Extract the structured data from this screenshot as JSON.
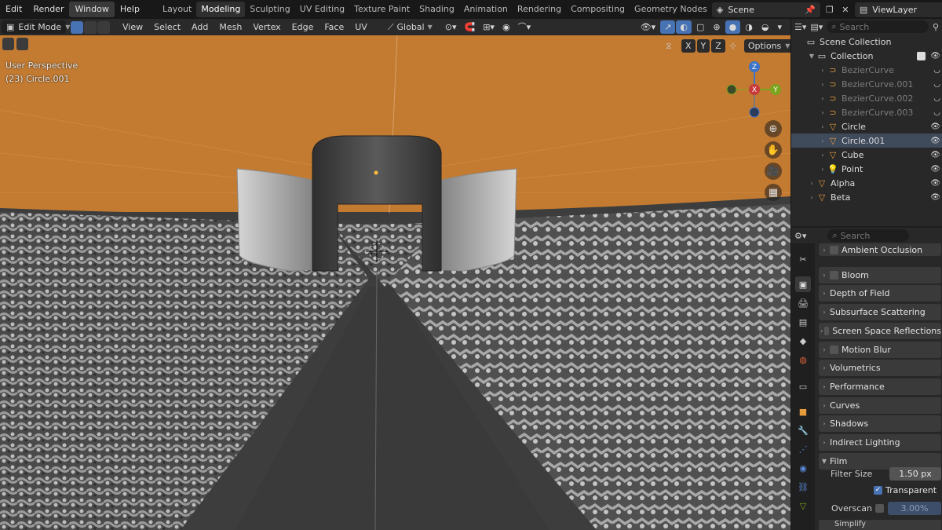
{
  "menu": [
    "Edit",
    "Render",
    "Window",
    "Help"
  ],
  "menu_active": "Window",
  "workspaces": [
    "Layout",
    "Modeling",
    "Sculpting",
    "UV Editing",
    "Texture Paint",
    "Shading",
    "Animation",
    "Rendering",
    "Compositing",
    "Geometry Nodes"
  ],
  "workspace_active": "Modeling",
  "scene_name": "Scene",
  "view_layer": "ViewLayer",
  "header": {
    "mode": "Edit Mode",
    "menus": [
      "View",
      "Select",
      "Add",
      "Mesh",
      "Vertex",
      "Edge",
      "Face",
      "UV"
    ],
    "transform_orientation": "Global",
    "axis_x": "X",
    "axis_y": "Y",
    "axis_z": "Z",
    "options": "Options"
  },
  "viewport": {
    "perspective": "User Perspective",
    "object": "(23) Circle.001"
  },
  "gizmo": {
    "x": "X",
    "y": "Y",
    "z": "Z"
  },
  "outliner": {
    "search_placeholder": "Search",
    "items": [
      {
        "label": "Scene Collection",
        "depth": 0,
        "icon": "scene-collection-icon"
      },
      {
        "label": "Collection",
        "depth": 1,
        "icon": "collection-icon",
        "checked": true
      },
      {
        "label": "BezierCurve",
        "depth": 2,
        "icon": "curve-icon",
        "dim": true
      },
      {
        "label": "BezierCurve.001",
        "depth": 2,
        "icon": "curve-icon",
        "dim": true
      },
      {
        "label": "BezierCurve.002",
        "depth": 2,
        "icon": "curve-icon",
        "dim": true
      },
      {
        "label": "BezierCurve.003",
        "depth": 2,
        "icon": "curve-icon",
        "dim": true
      },
      {
        "label": "Circle",
        "depth": 2,
        "icon": "mesh-icon"
      },
      {
        "label": "Circle.001",
        "depth": 2,
        "icon": "mesh-icon",
        "selected": true
      },
      {
        "label": "Cube",
        "depth": 2,
        "icon": "mesh-icon"
      },
      {
        "label": "Point",
        "depth": 2,
        "icon": "light-icon"
      },
      {
        "label": "Alpha",
        "depth": 1,
        "icon": "mesh-icon"
      },
      {
        "label": "Beta",
        "depth": 1,
        "icon": "mesh-icon"
      }
    ]
  },
  "properties": {
    "search_placeholder": "Search",
    "panels": [
      {
        "label": "Ambient Occlusion",
        "checkbox": true,
        "checked": false
      },
      {
        "label": "Bloom",
        "checkbox": true,
        "checked": false
      },
      {
        "label": "Depth of Field"
      },
      {
        "label": "Subsurface Scattering"
      },
      {
        "label": "Screen Space Reflections",
        "checkbox": true,
        "checked": false
      },
      {
        "label": "Motion Blur",
        "checkbox": true,
        "checked": false
      },
      {
        "label": "Volumetrics"
      },
      {
        "label": "Performance"
      },
      {
        "label": "Curves"
      },
      {
        "label": "Shadows"
      },
      {
        "label": "Indirect Lighting"
      },
      {
        "label": "Film",
        "open": true
      }
    ],
    "film": {
      "filter_size_label": "Filter Size",
      "filter_size_value": "1.50 px",
      "transparent_label": "Transparent",
      "transparent_checked": true,
      "overscan_label": "Overscan",
      "overscan_value": "3.00%"
    },
    "next_panel": "Simplify"
  },
  "colors": {
    "accent": "#4772b3",
    "world": "#c37b32",
    "ground": "#3d3d3d",
    "x_axis": "#c83a3a",
    "y_axis": "#7ca51e",
    "z_axis": "#3a73c8"
  }
}
